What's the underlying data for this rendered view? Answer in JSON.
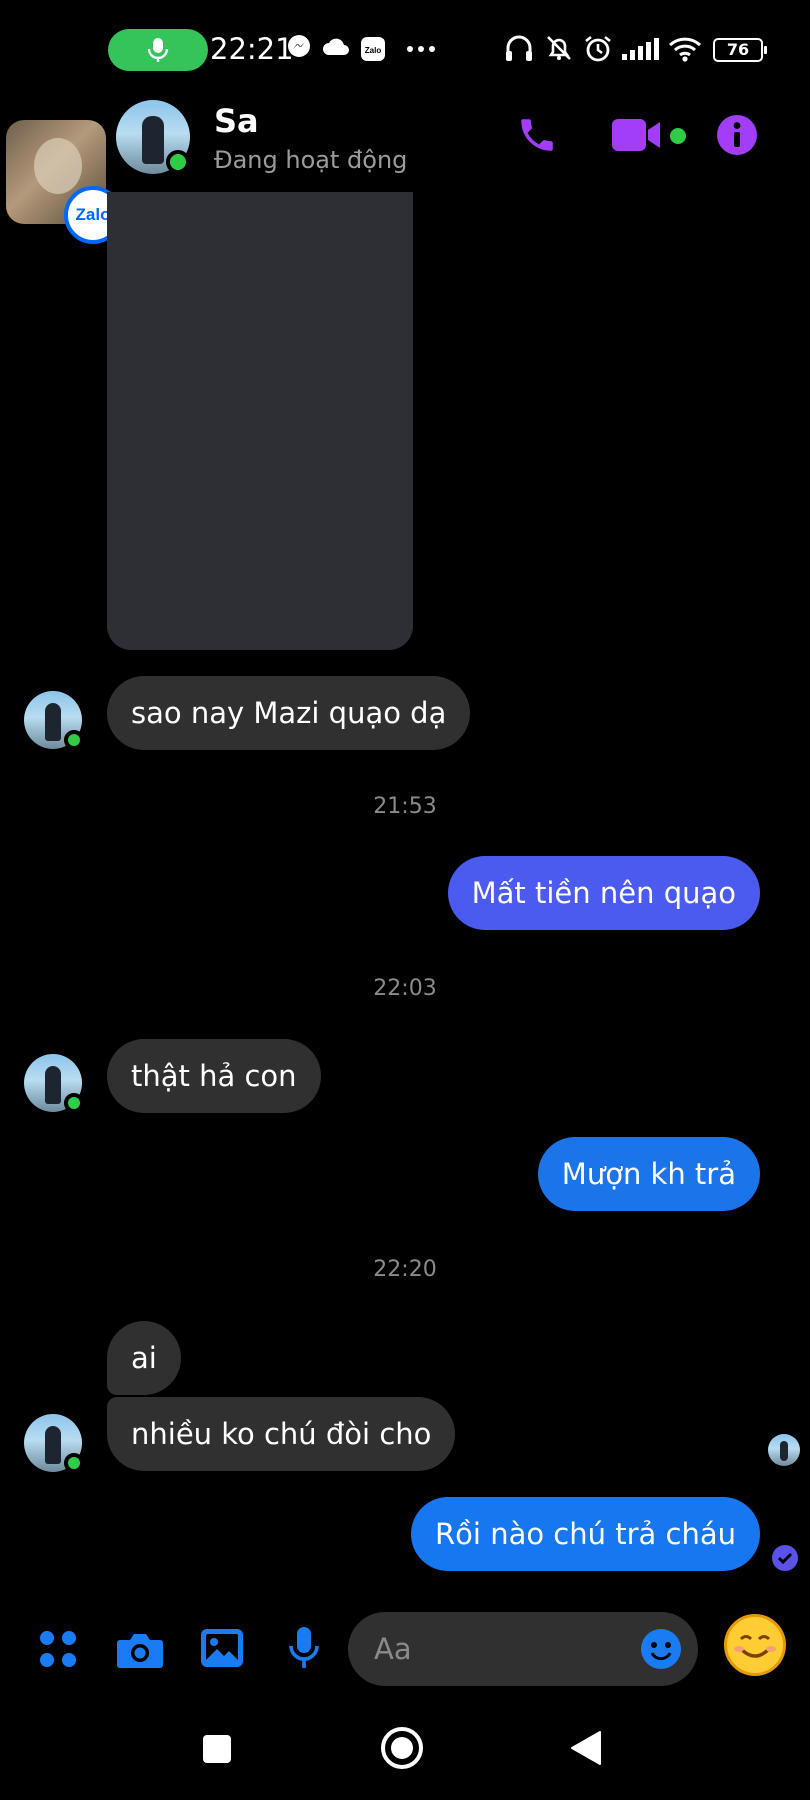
{
  "status_bar": {
    "time": "22:21",
    "battery": "76",
    "notification_icons": [
      "microphone-icon",
      "messenger-icon",
      "cloud-icon",
      "zalo-icon",
      "more-dots-icon"
    ],
    "system_icons": [
      "headphones-icon",
      "bell-off-icon",
      "alarm-icon",
      "signal-icon",
      "wifi-icon",
      "battery-icon"
    ]
  },
  "floating_bubble": {
    "app_label": "Zalo"
  },
  "header": {
    "contact_name": "Sa",
    "contact_status": "Đang hoạt động",
    "actions": [
      "phone-icon",
      "video-call-icon",
      "info-icon"
    ],
    "accent_color": "#a23ef7"
  },
  "messages": [
    {
      "type": "media",
      "direction": "in"
    },
    {
      "type": "text",
      "direction": "in",
      "text": "sao nay Mazi quạo dạ"
    },
    {
      "type": "time",
      "text": "21:53"
    },
    {
      "type": "text",
      "direction": "out",
      "text": "Mất tiền nên quạo",
      "color": "#4b5bf0"
    },
    {
      "type": "time",
      "text": "22:03"
    },
    {
      "type": "text",
      "direction": "in",
      "text": "thật hả con"
    },
    {
      "type": "text",
      "direction": "out",
      "text": "Mượn kh trả",
      "color": "#1b74e9"
    },
    {
      "type": "time",
      "text": "22:20"
    },
    {
      "type": "text",
      "direction": "in",
      "text": "ai"
    },
    {
      "type": "text",
      "direction": "in",
      "text": "nhiều ko chú đòi cho"
    },
    {
      "type": "text",
      "direction": "out",
      "text": "Rồi nào chú trả cháu",
      "color": "#1677f0"
    }
  ],
  "composer": {
    "placeholder": "Aa",
    "tools": [
      "apps-grid-icon",
      "camera-icon",
      "gallery-icon",
      "microphone-icon"
    ],
    "accent_color": "#1a7cf2"
  },
  "nav_bar": [
    "recents-square-icon",
    "home-circle-icon",
    "back-triangle-icon"
  ]
}
